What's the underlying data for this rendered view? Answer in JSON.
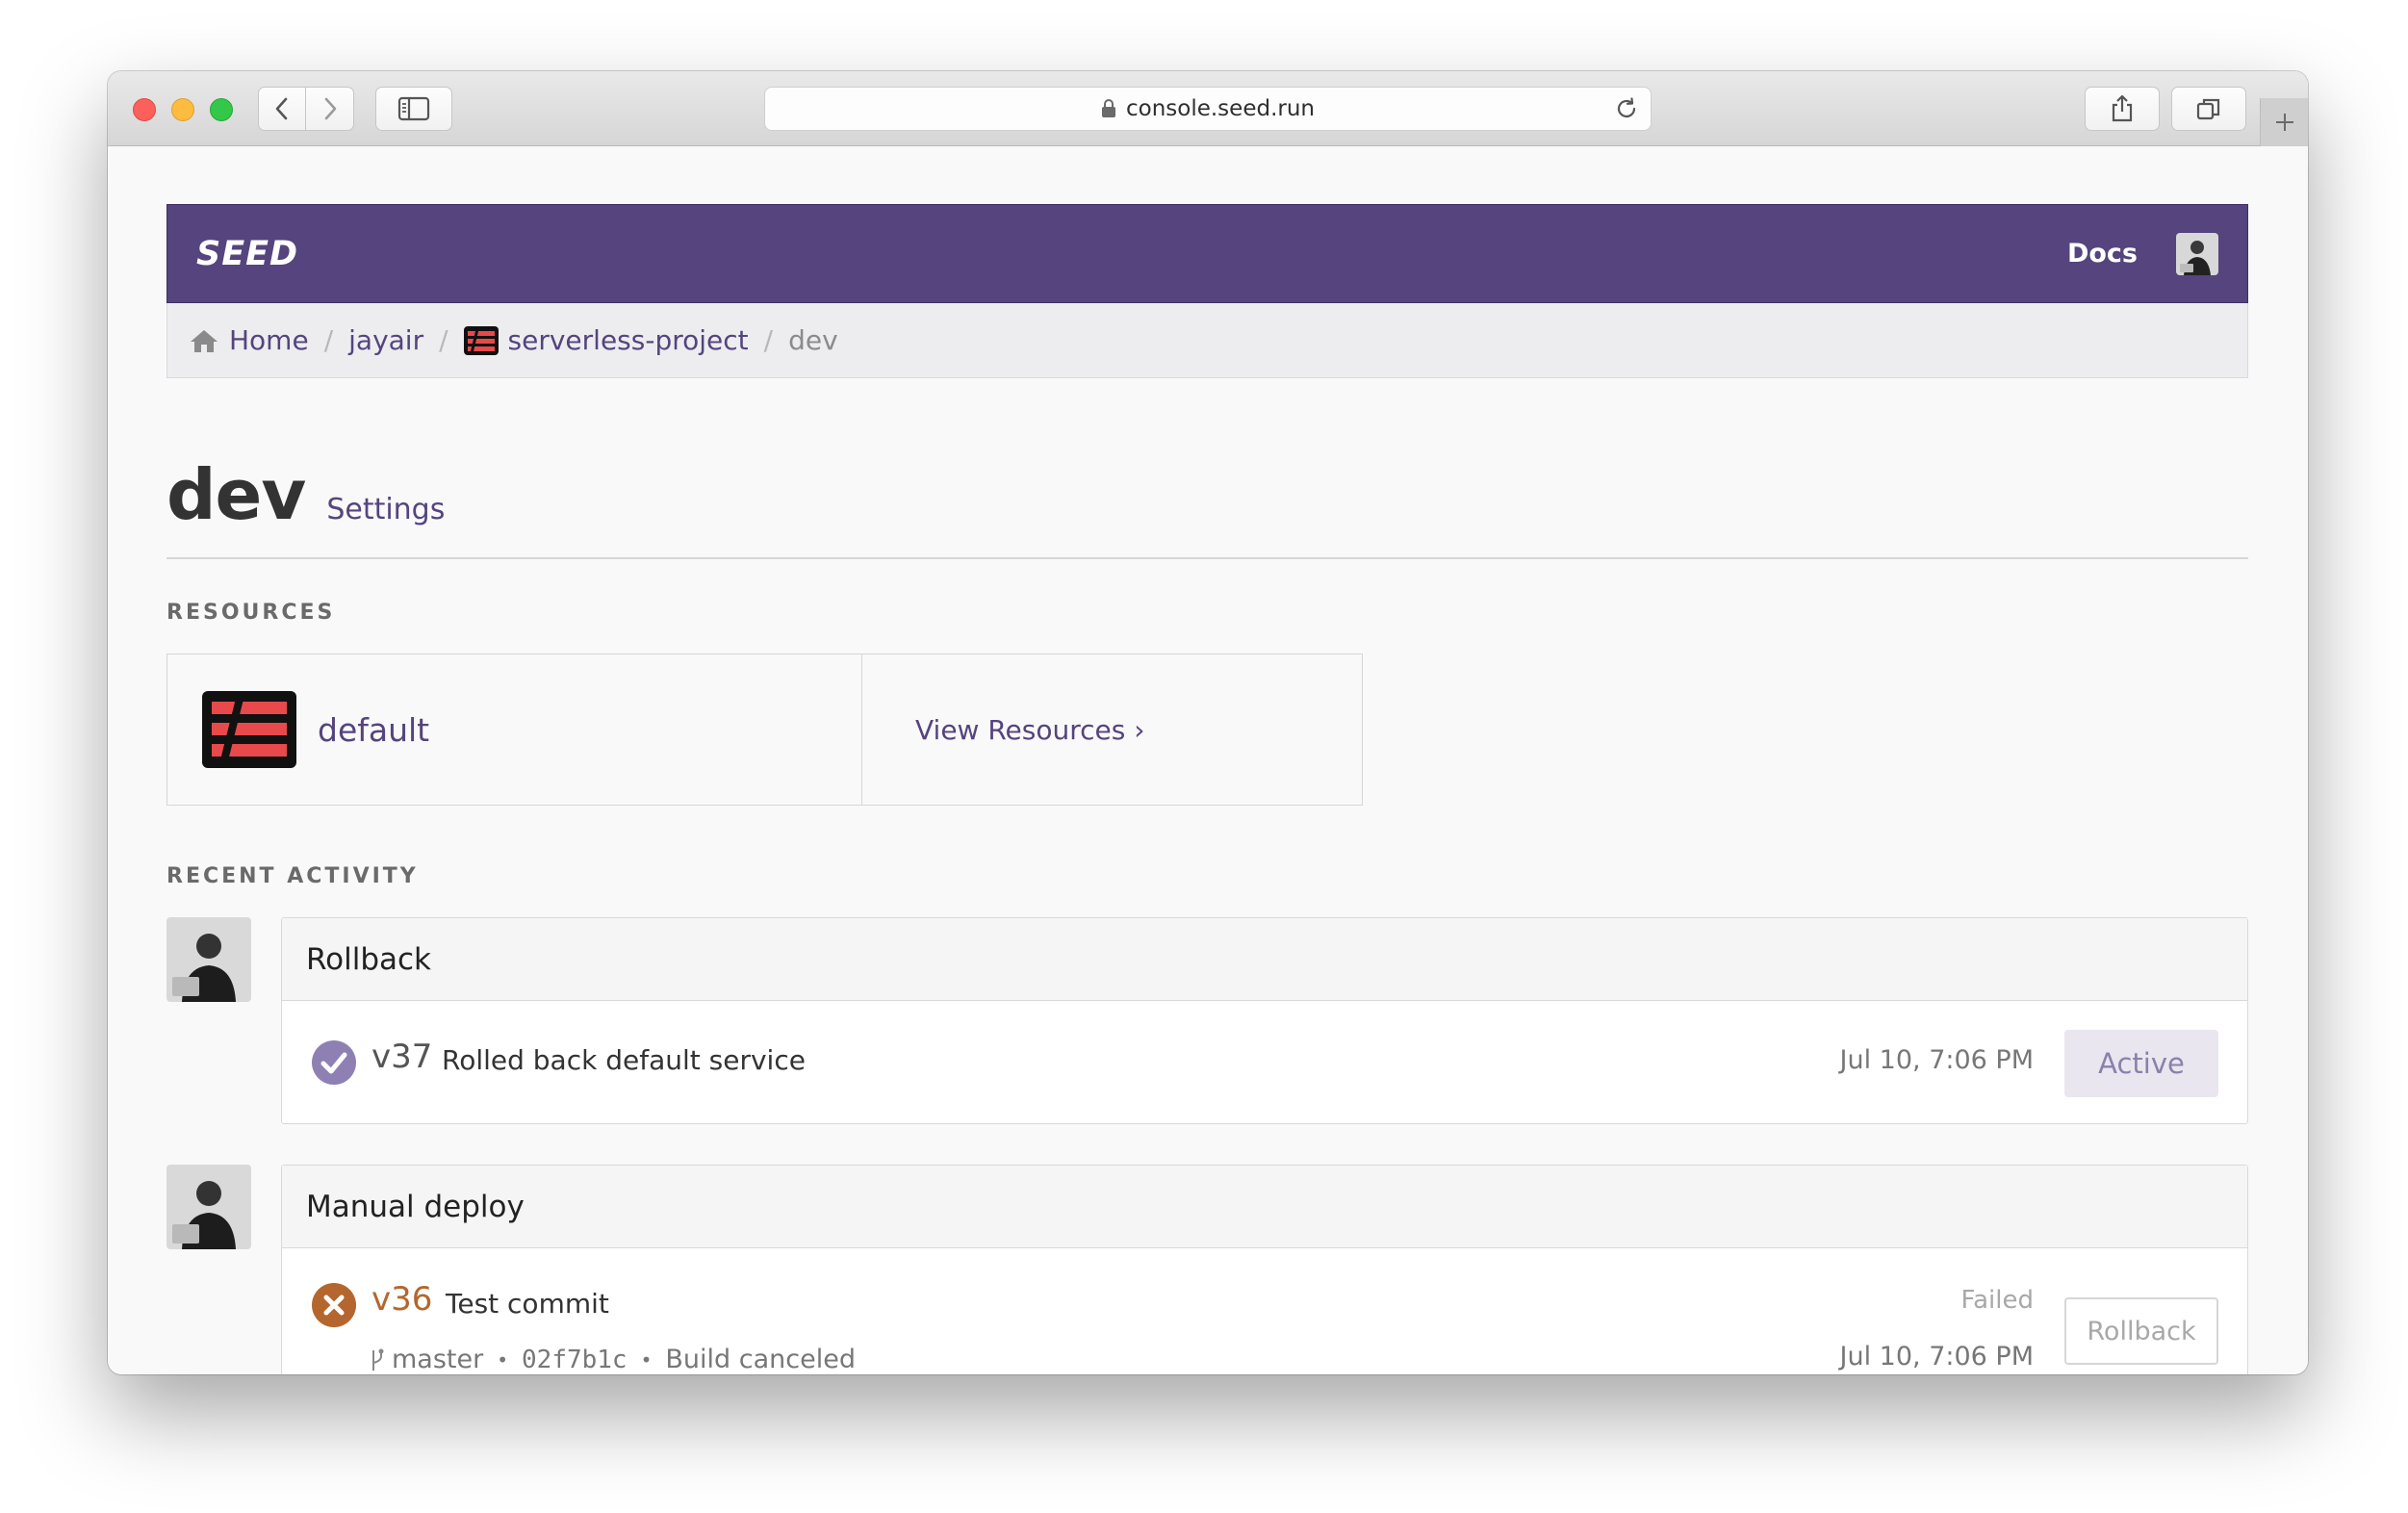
{
  "browser": {
    "url": "console.seed.run"
  },
  "navbar": {
    "logo": "SEED",
    "docs_label": "Docs"
  },
  "breadcrumb": {
    "items": [
      {
        "label": "Home"
      },
      {
        "label": "jayair"
      },
      {
        "label": "serverless-project"
      },
      {
        "label": "dev"
      }
    ],
    "separator": "/"
  },
  "header": {
    "title": "dev",
    "settings_label": "Settings"
  },
  "resources": {
    "section_label": "RESOURCES",
    "service_name": "default",
    "view_label": "View Resources ›"
  },
  "activity": {
    "section_label": "RECENT ACTIVITY",
    "items": [
      {
        "type": "Rollback",
        "version": "v37",
        "message": "Rolled back default service",
        "time": "Jul 10, 7:06 PM",
        "action": "Active",
        "status_color": "#8f80b4"
      },
      {
        "type": "Manual deploy",
        "version": "v36",
        "message": "Test commit",
        "status": "Failed",
        "time": "Jul 10, 7:06 PM",
        "action": "Rollback",
        "branch": "master",
        "commit": "02f7b1c",
        "detail": "Build canceled",
        "status_color": "#b4662e"
      }
    ]
  },
  "colors": {
    "brand": "#55447e",
    "service_icon": "#e8494a"
  }
}
